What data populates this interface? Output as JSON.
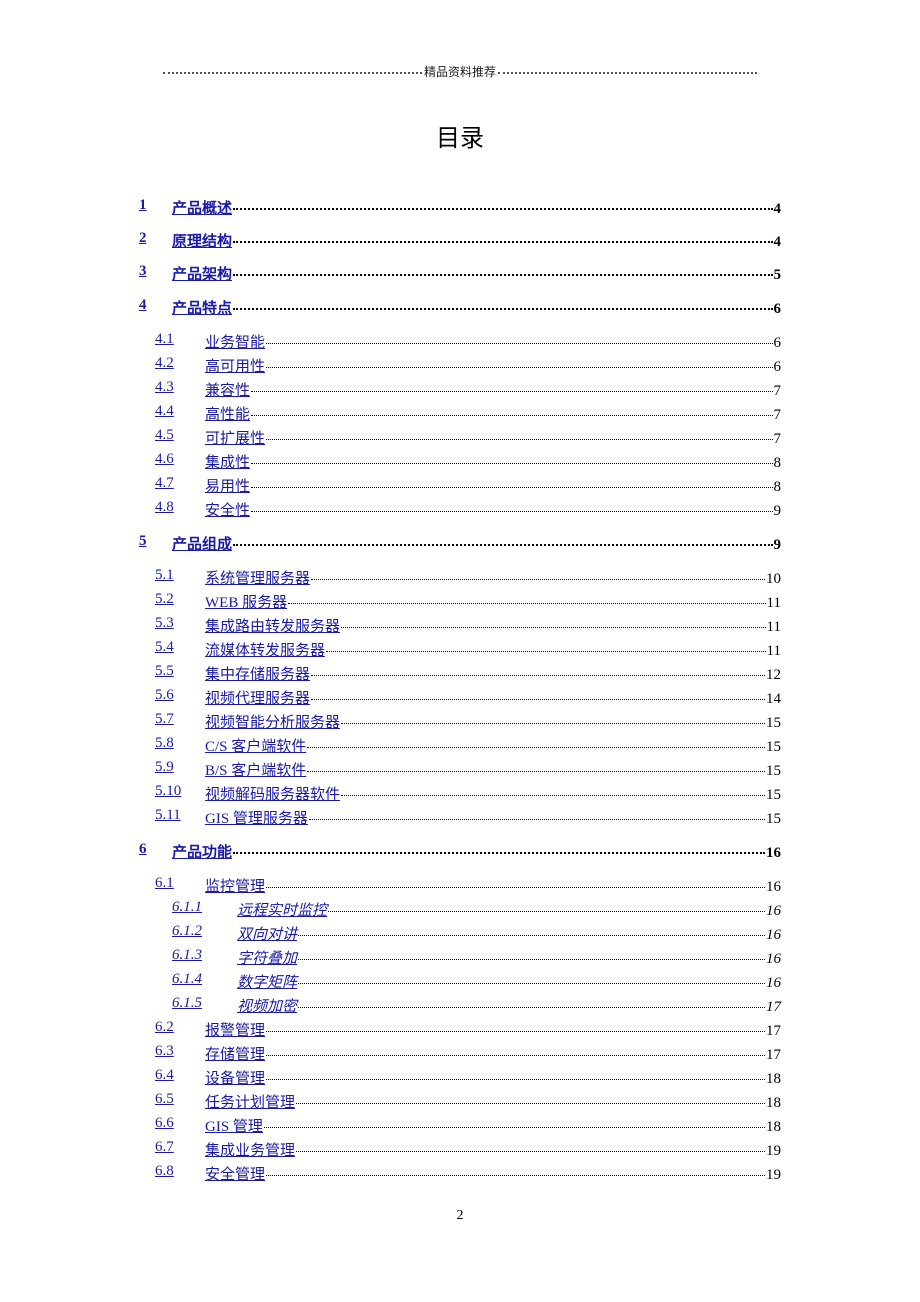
{
  "header": {
    "text": "精品资料推荐"
  },
  "title": "目录",
  "toc": [
    {
      "level": 1,
      "num": "1",
      "label": "产品概述",
      "page": "4"
    },
    {
      "level": 1,
      "num": "2",
      "label": "原理结构",
      "page": "4"
    },
    {
      "level": 1,
      "num": "3",
      "label": "产品架构",
      "page": "5"
    },
    {
      "level": 1,
      "num": "4",
      "label": "产品特点",
      "page": "6"
    },
    {
      "level": 2,
      "num": "4.1",
      "label": "业务智能",
      "page": "6"
    },
    {
      "level": 2,
      "num": "4.2",
      "label": "高可用性",
      "page": "6"
    },
    {
      "level": 2,
      "num": "4.3",
      "label": "兼容性",
      "page": "7"
    },
    {
      "level": 2,
      "num": "4.4",
      "label": "高性能",
      "page": "7"
    },
    {
      "level": 2,
      "num": "4.5",
      "label": "可扩展性",
      "page": "7"
    },
    {
      "level": 2,
      "num": "4.6",
      "label": "集成性",
      "page": "8"
    },
    {
      "level": 2,
      "num": "4.7",
      "label": "易用性",
      "page": "8"
    },
    {
      "level": 2,
      "num": "4.8",
      "label": "安全性",
      "page": "9"
    },
    {
      "level": 1,
      "num": "5",
      "label": "产品组成",
      "page": "9"
    },
    {
      "level": 2,
      "num": "5.1",
      "label": "系统管理服务器",
      "page": "10"
    },
    {
      "level": 2,
      "num": "5.2",
      "label": "WEB 服务器",
      "page": "11"
    },
    {
      "level": 2,
      "num": "5.3",
      "label": "集成路由转发服务器",
      "page": "11"
    },
    {
      "level": 2,
      "num": "5.4",
      "label": "流媒体转发服务器",
      "page": "11"
    },
    {
      "level": 2,
      "num": "5.5",
      "label": "集中存储服务器",
      "page": "12"
    },
    {
      "level": 2,
      "num": "5.6",
      "label": "视频代理服务器",
      "page": "14"
    },
    {
      "level": 2,
      "num": "5.7",
      "label": "视频智能分析服务器",
      "page": "15"
    },
    {
      "level": 2,
      "num": "5.8",
      "label": "C/S 客户端软件",
      "page": "15"
    },
    {
      "level": 2,
      "num": "5.9",
      "label": "B/S 客户端软件",
      "page": "15"
    },
    {
      "level": 2,
      "num": "5.10",
      "label": "视频解码服务器软件",
      "page": "15"
    },
    {
      "level": 2,
      "num": "5.11",
      "label": "GIS 管理服务器",
      "page": "15"
    },
    {
      "level": 1,
      "num": "6",
      "label": "产品功能",
      "page": "16"
    },
    {
      "level": 2,
      "num": "6.1",
      "label": "监控管理",
      "page": "16"
    },
    {
      "level": 3,
      "num": "6.1.1",
      "label": "远程实时监控",
      "page": "16"
    },
    {
      "level": 3,
      "num": "6.1.2",
      "label": "双向对讲",
      "page": "16"
    },
    {
      "level": 3,
      "num": "6.1.3",
      "label": "字符叠加",
      "page": "16"
    },
    {
      "level": 3,
      "num": "6.1.4",
      "label": "数字矩阵",
      "page": "16"
    },
    {
      "level": 3,
      "num": "6.1.5",
      "label": "视频加密",
      "page": "17"
    },
    {
      "level": 2,
      "num": "6.2",
      "label": "报警管理",
      "page": "17"
    },
    {
      "level": 2,
      "num": "6.3",
      "label": "存储管理",
      "page": "17"
    },
    {
      "level": 2,
      "num": "6.4",
      "label": "设备管理",
      "page": "18"
    },
    {
      "level": 2,
      "num": "6.5",
      "label": "任务计划管理",
      "page": "18"
    },
    {
      "level": 2,
      "num": "6.6",
      "label": "GIS 管理",
      "page": "18"
    },
    {
      "level": 2,
      "num": "6.7",
      "label": "集成业务管理",
      "page": "19"
    },
    {
      "level": 2,
      "num": "6.8",
      "label": "安全管理",
      "page": "19"
    }
  ],
  "footer": {
    "page_number": "2"
  }
}
